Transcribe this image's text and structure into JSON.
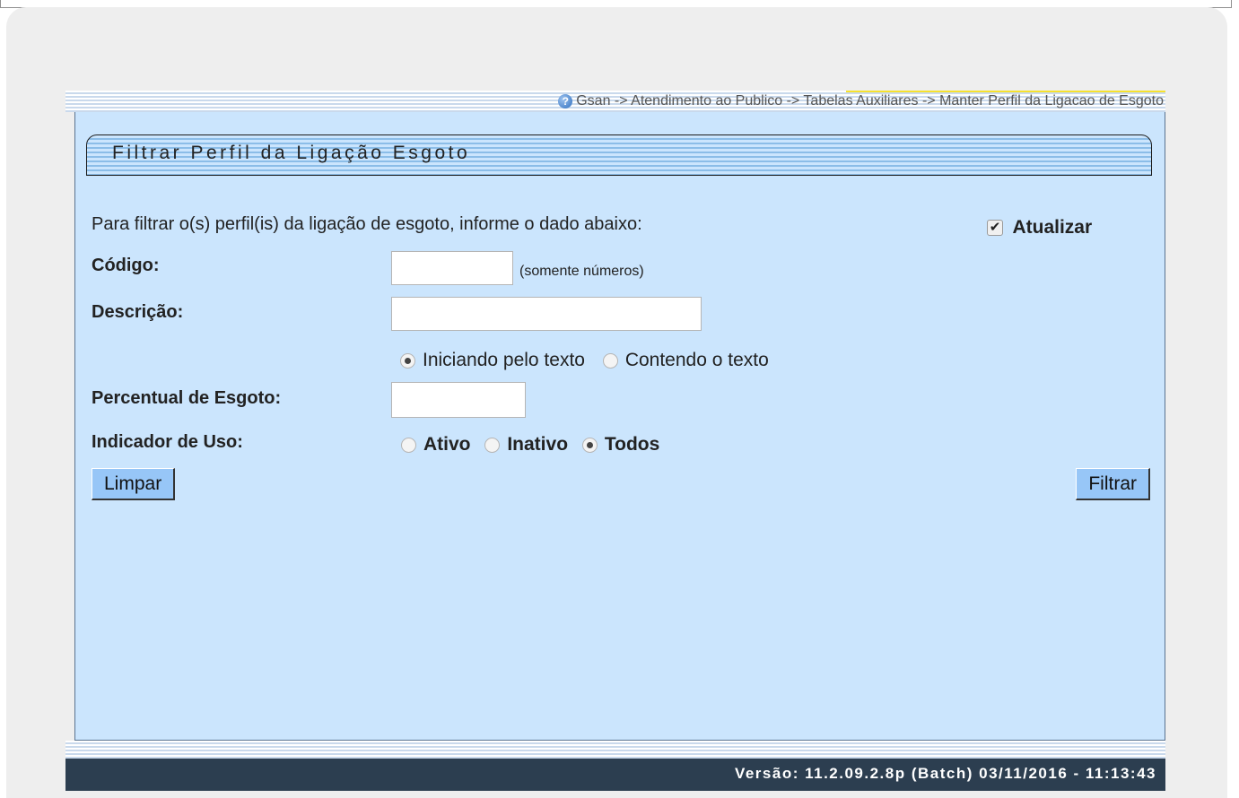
{
  "breadcrumb": "Gsan -> Atendimento ao Publico -> Tabelas Auxiliares -> Manter Perfil da Ligacao de Esgoto",
  "form": {
    "title": "Filtrar Perfil da Ligação Esgoto",
    "instructions": "Para filtrar o(s) perfil(is) da ligação de esgoto, informe o dado abaixo:",
    "atualizar_label": "Atualizar",
    "atualizar_checked": true,
    "codigo_label": "Código:",
    "codigo_value": "",
    "codigo_hint": "(somente números)",
    "descricao_label": "Descrição:",
    "descricao_value": "",
    "descricao_options": [
      {
        "label": "Iniciando pelo texto",
        "checked": true
      },
      {
        "label": "Contendo o texto",
        "checked": false
      }
    ],
    "percentual_label": "Percentual de Esgoto:",
    "percentual_value": "",
    "indicador_label": "Indicador de Uso:",
    "indicador_options": [
      {
        "label": "Ativo",
        "checked": false
      },
      {
        "label": "Inativo",
        "checked": false
      },
      {
        "label": "Todos",
        "checked": true
      }
    ],
    "limpar_label": "Limpar",
    "filtrar_label": "Filtrar"
  },
  "footer": {
    "version_text": "Versão: 11.2.09.2.8p (Batch) 03/11/2016 - 11:13:43"
  },
  "colors": {
    "panel_bg": "#cbe5fd",
    "button_bg": "#97c6f7",
    "footer_bg": "#2c3e50"
  }
}
